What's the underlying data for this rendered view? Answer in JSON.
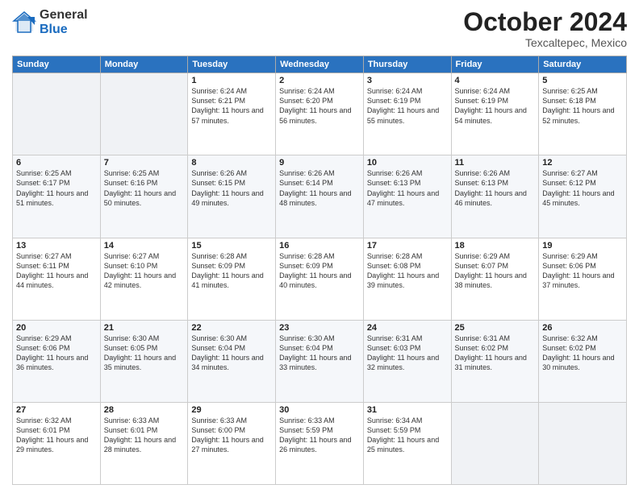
{
  "header": {
    "logo_general": "General",
    "logo_blue": "Blue",
    "title": "October 2024",
    "location": "Texcaltepec, Mexico"
  },
  "weekdays": [
    "Sunday",
    "Monday",
    "Tuesday",
    "Wednesday",
    "Thursday",
    "Friday",
    "Saturday"
  ],
  "weeks": [
    [
      {
        "day": "",
        "sunrise": "",
        "sunset": "",
        "daylight": ""
      },
      {
        "day": "",
        "sunrise": "",
        "sunset": "",
        "daylight": ""
      },
      {
        "day": "1",
        "sunrise": "Sunrise: 6:24 AM",
        "sunset": "Sunset: 6:21 PM",
        "daylight": "Daylight: 11 hours and 57 minutes."
      },
      {
        "day": "2",
        "sunrise": "Sunrise: 6:24 AM",
        "sunset": "Sunset: 6:20 PM",
        "daylight": "Daylight: 11 hours and 56 minutes."
      },
      {
        "day": "3",
        "sunrise": "Sunrise: 6:24 AM",
        "sunset": "Sunset: 6:19 PM",
        "daylight": "Daylight: 11 hours and 55 minutes."
      },
      {
        "day": "4",
        "sunrise": "Sunrise: 6:24 AM",
        "sunset": "Sunset: 6:19 PM",
        "daylight": "Daylight: 11 hours and 54 minutes."
      },
      {
        "day": "5",
        "sunrise": "Sunrise: 6:25 AM",
        "sunset": "Sunset: 6:18 PM",
        "daylight": "Daylight: 11 hours and 52 minutes."
      }
    ],
    [
      {
        "day": "6",
        "sunrise": "Sunrise: 6:25 AM",
        "sunset": "Sunset: 6:17 PM",
        "daylight": "Daylight: 11 hours and 51 minutes."
      },
      {
        "day": "7",
        "sunrise": "Sunrise: 6:25 AM",
        "sunset": "Sunset: 6:16 PM",
        "daylight": "Daylight: 11 hours and 50 minutes."
      },
      {
        "day": "8",
        "sunrise": "Sunrise: 6:26 AM",
        "sunset": "Sunset: 6:15 PM",
        "daylight": "Daylight: 11 hours and 49 minutes."
      },
      {
        "day": "9",
        "sunrise": "Sunrise: 6:26 AM",
        "sunset": "Sunset: 6:14 PM",
        "daylight": "Daylight: 11 hours and 48 minutes."
      },
      {
        "day": "10",
        "sunrise": "Sunrise: 6:26 AM",
        "sunset": "Sunset: 6:13 PM",
        "daylight": "Daylight: 11 hours and 47 minutes."
      },
      {
        "day": "11",
        "sunrise": "Sunrise: 6:26 AM",
        "sunset": "Sunset: 6:13 PM",
        "daylight": "Daylight: 11 hours and 46 minutes."
      },
      {
        "day": "12",
        "sunrise": "Sunrise: 6:27 AM",
        "sunset": "Sunset: 6:12 PM",
        "daylight": "Daylight: 11 hours and 45 minutes."
      }
    ],
    [
      {
        "day": "13",
        "sunrise": "Sunrise: 6:27 AM",
        "sunset": "Sunset: 6:11 PM",
        "daylight": "Daylight: 11 hours and 44 minutes."
      },
      {
        "day": "14",
        "sunrise": "Sunrise: 6:27 AM",
        "sunset": "Sunset: 6:10 PM",
        "daylight": "Daylight: 11 hours and 42 minutes."
      },
      {
        "day": "15",
        "sunrise": "Sunrise: 6:28 AM",
        "sunset": "Sunset: 6:09 PM",
        "daylight": "Daylight: 11 hours and 41 minutes."
      },
      {
        "day": "16",
        "sunrise": "Sunrise: 6:28 AM",
        "sunset": "Sunset: 6:09 PM",
        "daylight": "Daylight: 11 hours and 40 minutes."
      },
      {
        "day": "17",
        "sunrise": "Sunrise: 6:28 AM",
        "sunset": "Sunset: 6:08 PM",
        "daylight": "Daylight: 11 hours and 39 minutes."
      },
      {
        "day": "18",
        "sunrise": "Sunrise: 6:29 AM",
        "sunset": "Sunset: 6:07 PM",
        "daylight": "Daylight: 11 hours and 38 minutes."
      },
      {
        "day": "19",
        "sunrise": "Sunrise: 6:29 AM",
        "sunset": "Sunset: 6:06 PM",
        "daylight": "Daylight: 11 hours and 37 minutes."
      }
    ],
    [
      {
        "day": "20",
        "sunrise": "Sunrise: 6:29 AM",
        "sunset": "Sunset: 6:06 PM",
        "daylight": "Daylight: 11 hours and 36 minutes."
      },
      {
        "day": "21",
        "sunrise": "Sunrise: 6:30 AM",
        "sunset": "Sunset: 6:05 PM",
        "daylight": "Daylight: 11 hours and 35 minutes."
      },
      {
        "day": "22",
        "sunrise": "Sunrise: 6:30 AM",
        "sunset": "Sunset: 6:04 PM",
        "daylight": "Daylight: 11 hours and 34 minutes."
      },
      {
        "day": "23",
        "sunrise": "Sunrise: 6:30 AM",
        "sunset": "Sunset: 6:04 PM",
        "daylight": "Daylight: 11 hours and 33 minutes."
      },
      {
        "day": "24",
        "sunrise": "Sunrise: 6:31 AM",
        "sunset": "Sunset: 6:03 PM",
        "daylight": "Daylight: 11 hours and 32 minutes."
      },
      {
        "day": "25",
        "sunrise": "Sunrise: 6:31 AM",
        "sunset": "Sunset: 6:02 PM",
        "daylight": "Daylight: 11 hours and 31 minutes."
      },
      {
        "day": "26",
        "sunrise": "Sunrise: 6:32 AM",
        "sunset": "Sunset: 6:02 PM",
        "daylight": "Daylight: 11 hours and 30 minutes."
      }
    ],
    [
      {
        "day": "27",
        "sunrise": "Sunrise: 6:32 AM",
        "sunset": "Sunset: 6:01 PM",
        "daylight": "Daylight: 11 hours and 29 minutes."
      },
      {
        "day": "28",
        "sunrise": "Sunrise: 6:33 AM",
        "sunset": "Sunset: 6:01 PM",
        "daylight": "Daylight: 11 hours and 28 minutes."
      },
      {
        "day": "29",
        "sunrise": "Sunrise: 6:33 AM",
        "sunset": "Sunset: 6:00 PM",
        "daylight": "Daylight: 11 hours and 27 minutes."
      },
      {
        "day": "30",
        "sunrise": "Sunrise: 6:33 AM",
        "sunset": "Sunset: 5:59 PM",
        "daylight": "Daylight: 11 hours and 26 minutes."
      },
      {
        "day": "31",
        "sunrise": "Sunrise: 6:34 AM",
        "sunset": "Sunset: 5:59 PM",
        "daylight": "Daylight: 11 hours and 25 minutes."
      },
      {
        "day": "",
        "sunrise": "",
        "sunset": "",
        "daylight": ""
      },
      {
        "day": "",
        "sunrise": "",
        "sunset": "",
        "daylight": ""
      }
    ]
  ]
}
